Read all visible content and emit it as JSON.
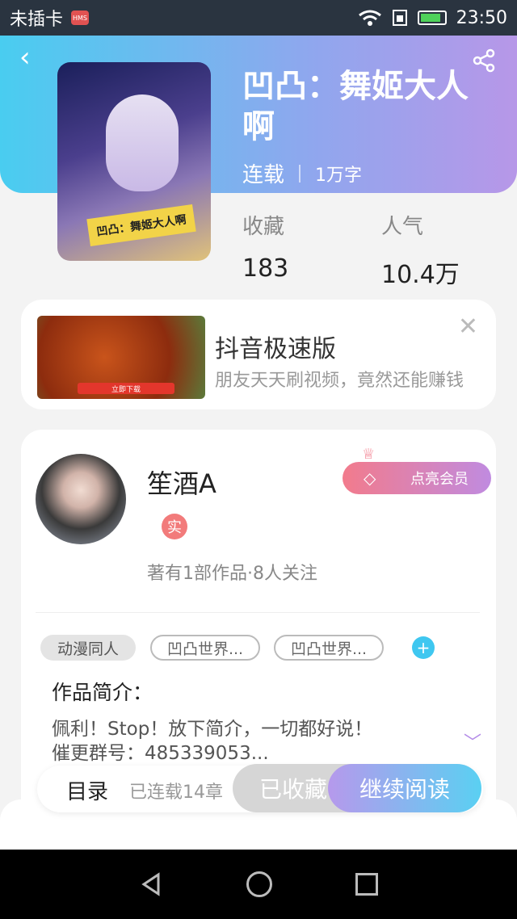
{
  "status_bar": {
    "carrier": "未插卡",
    "hms": "HMS",
    "time": "23:50"
  },
  "header": {
    "title": "凹凸：舞姬大人啊",
    "status": "连载",
    "words": "1万字",
    "favorites_label": "收藏",
    "favorites_value": "183",
    "popularity_label": "人气",
    "popularity_value": "10.4万",
    "cover_caption": "凹凸：舞姬大人啊"
  },
  "ad": {
    "name": "抖音极速版",
    "description": "朋友天天刷视频，竟然还能赚钱",
    "cta": "立即下载"
  },
  "author": {
    "name": "笙酒A",
    "verified": "实",
    "stats": "著有1部作品·8人关注",
    "vip_label": "点亮会员"
  },
  "tags": [
    "动漫同人",
    "凹凸世界...",
    "凹凸世界..."
  ],
  "intro": {
    "title": "作品简介：",
    "text_line1": "佩利！Stop！放下简介，一切都好说！",
    "text_line2": "催更群号：485339053..."
  },
  "bottom": {
    "toc": "目录",
    "serial": "已连载14章",
    "favorited": "已收藏",
    "continue": "继续阅读"
  },
  "colors": {
    "accent_blue": "#49cdf0",
    "accent_purple": "#b797e8",
    "vip_pink": "#f27b8c"
  }
}
